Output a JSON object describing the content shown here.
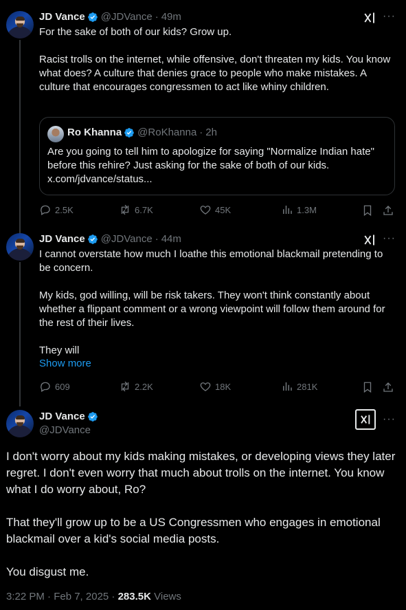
{
  "colors": {
    "background": "#000000",
    "text": "#e7e9ea",
    "muted": "#71767b",
    "link": "#1d9bf0",
    "verified": "#1d9bf0",
    "border": "#2f3336"
  },
  "posts": [
    {
      "name": "JD Vance",
      "handle": "@JDVance",
      "separator": "·",
      "time": "49m",
      "text": "For the sake of both of our kids? Grow up.\n\nRacist trolls on the internet, while offensive, don't threaten my kids. You know what does? A culture that denies grace to people who make mistakes. A culture that encourages congressmen to act like whiny children.",
      "quote": {
        "name": "Ro Khanna",
        "handle": "@RoKhanna",
        "separator": "·",
        "time": "2h",
        "text": "Are you going to tell him to apologize for saying \"Normalize Indian hate\" before this rehire? Just asking for the sake of both of our kids.",
        "link": "x.com/jdvance/status..."
      },
      "metrics": {
        "replies": "2.5K",
        "reposts": "6.7K",
        "likes": "45K",
        "views": "1.3M"
      }
    },
    {
      "name": "JD Vance",
      "handle": "@JDVance",
      "separator": "·",
      "time": "44m",
      "text": "I cannot overstate how much I loathe this emotional blackmail pretending to be concern.\n\nMy kids, god willing, will be risk takers. They won't think constantly about whether a flippant comment or a wrong viewpoint will follow them around for the rest of their lives.\n\nThey will",
      "show_more": "Show more",
      "metrics": {
        "replies": "609",
        "reposts": "2.2K",
        "likes": "18K",
        "views": "281K"
      }
    }
  ],
  "main": {
    "name": "JD Vance",
    "handle": "@JDVance",
    "text": "I don't worry about my kids making mistakes, or developing views they later regret. I don't even worry that much about trolls on the internet. You know what I do worry about, Ro?\n\nThat they'll grow up to be a US Congressmen who engages in emotional blackmail over a kid's social media posts.\n\nYou disgust me.",
    "timestamp": "3:22 PM · Feb 7, 2025 · ",
    "views_count": "283.5K",
    "views_label": "Views"
  },
  "icons": [
    "verified-icon",
    "grok-icon",
    "more-icon",
    "reply-icon",
    "repost-icon",
    "like-icon",
    "views-icon",
    "bookmark-icon",
    "share-icon"
  ]
}
